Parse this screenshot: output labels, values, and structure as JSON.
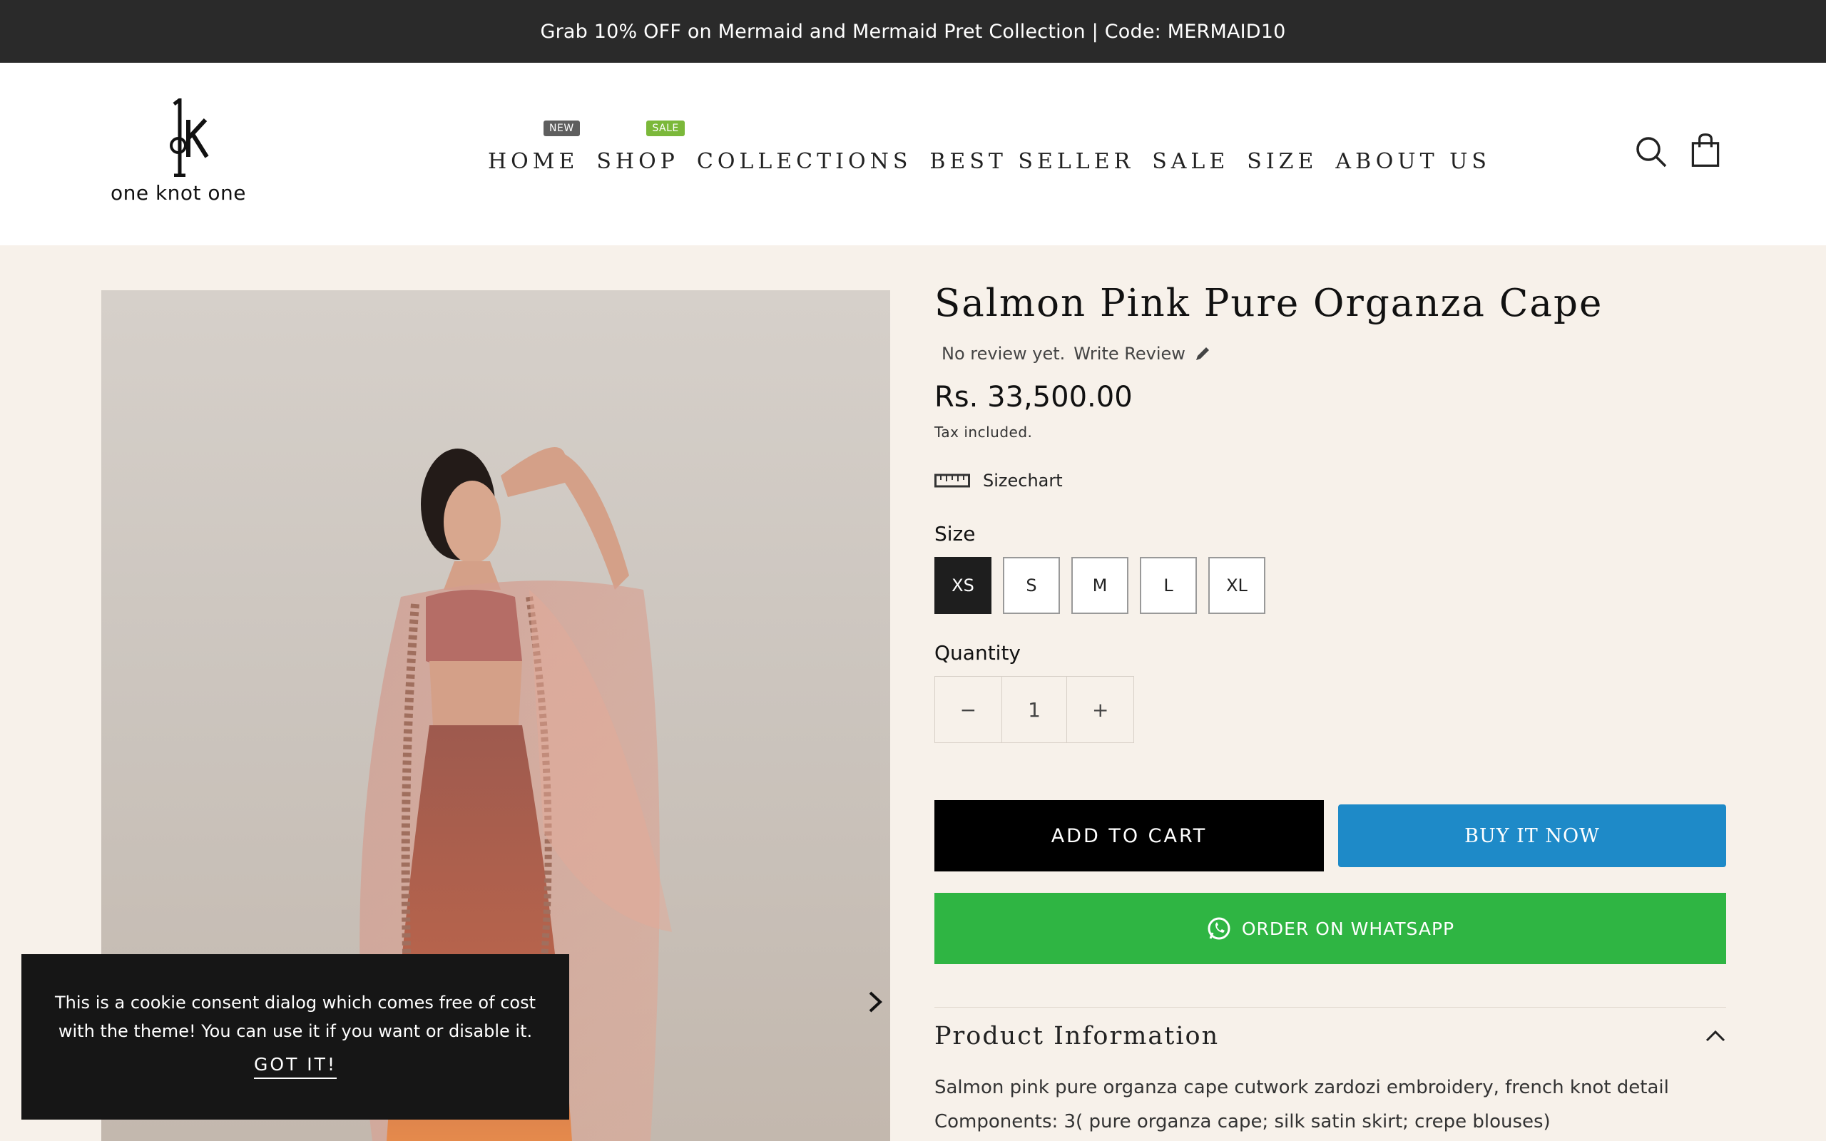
{
  "announcement": "Grab 10% OFF on Mermaid and Mermaid Pret Collection  |  Code: MERMAID10",
  "brand": {
    "name": "one knot one",
    "mark": "1K"
  },
  "nav": {
    "items": [
      {
        "label": "HOME",
        "badge": "NEW"
      },
      {
        "label": "SHOP",
        "badge": "SALE"
      },
      {
        "label": "COLLECTIONS"
      },
      {
        "label": "BEST SELLER"
      },
      {
        "label": "SALE"
      },
      {
        "label": "SIZE"
      },
      {
        "label": "ABOUT US"
      }
    ],
    "badge_colors": {
      "new": "#5e5e5e",
      "sale": "#7bb83a"
    }
  },
  "header_icons": [
    "search-icon",
    "shopping-bag-icon"
  ],
  "product": {
    "title": "Salmon Pink Pure Organza Cape",
    "review_text": "No review yet.",
    "write_review": "Write Review",
    "price": "Rs. 33,500.00",
    "tax_note": "Tax included.",
    "sizechart": "Sizechart",
    "size_label": "Size",
    "sizes": [
      "XS",
      "S",
      "M",
      "L",
      "XL"
    ],
    "selected_size": "XS",
    "quantity_label": "Quantity",
    "quantity": "1",
    "qty_minus": "−",
    "qty_plus": "+",
    "add_to_cart": "ADD TO CART",
    "buy_now": "BUY IT NOW",
    "whatsapp": "ORDER ON WHATSAPP",
    "info_title": "Product Information",
    "info_lines": [
      "Salmon pink pure organza cape cutwork zardozi embroidery, french knot detail",
      "Components: 3( pure organza cape; silk satin skirt; crepe blouses)"
    ]
  },
  "cookie": {
    "message": "This is a cookie consent dialog which comes free of cost with the theme! You can use it if you want or disable it.",
    "button": "GOT IT!"
  },
  "colors": {
    "accent_blue": "#1e8ac8",
    "whatsapp_green": "#2fb543",
    "page_bg": "#f7f1ea"
  }
}
